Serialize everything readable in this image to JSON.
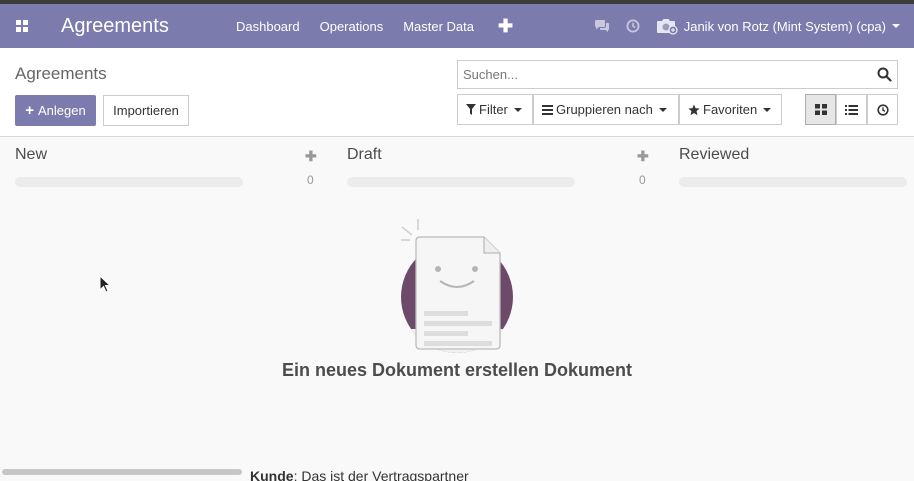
{
  "navbar": {
    "brand": "Agreements",
    "menu": [
      "Dashboard",
      "Operations",
      "Master Data"
    ],
    "user": "Janik von Rotz (Mint System) (cpa)",
    "accent": "#7c7bad"
  },
  "control": {
    "title": "Agreements",
    "create_label": "Anlegen",
    "import_label": "Importieren",
    "search_placeholder": "Suchen...",
    "filter_label": "Filter",
    "group_label": "Gruppieren nach",
    "favorites_label": "Favoriten"
  },
  "kanban": {
    "columns": [
      {
        "title": "New",
        "count": "0"
      },
      {
        "title": "Draft",
        "count": "0"
      },
      {
        "title": "Reviewed"
      }
    ],
    "empty_title": "Ein neues Dokument erstellen Dokument",
    "footer_bold": "Kunde",
    "footer_text": ": Das ist der Vertragspartner"
  }
}
